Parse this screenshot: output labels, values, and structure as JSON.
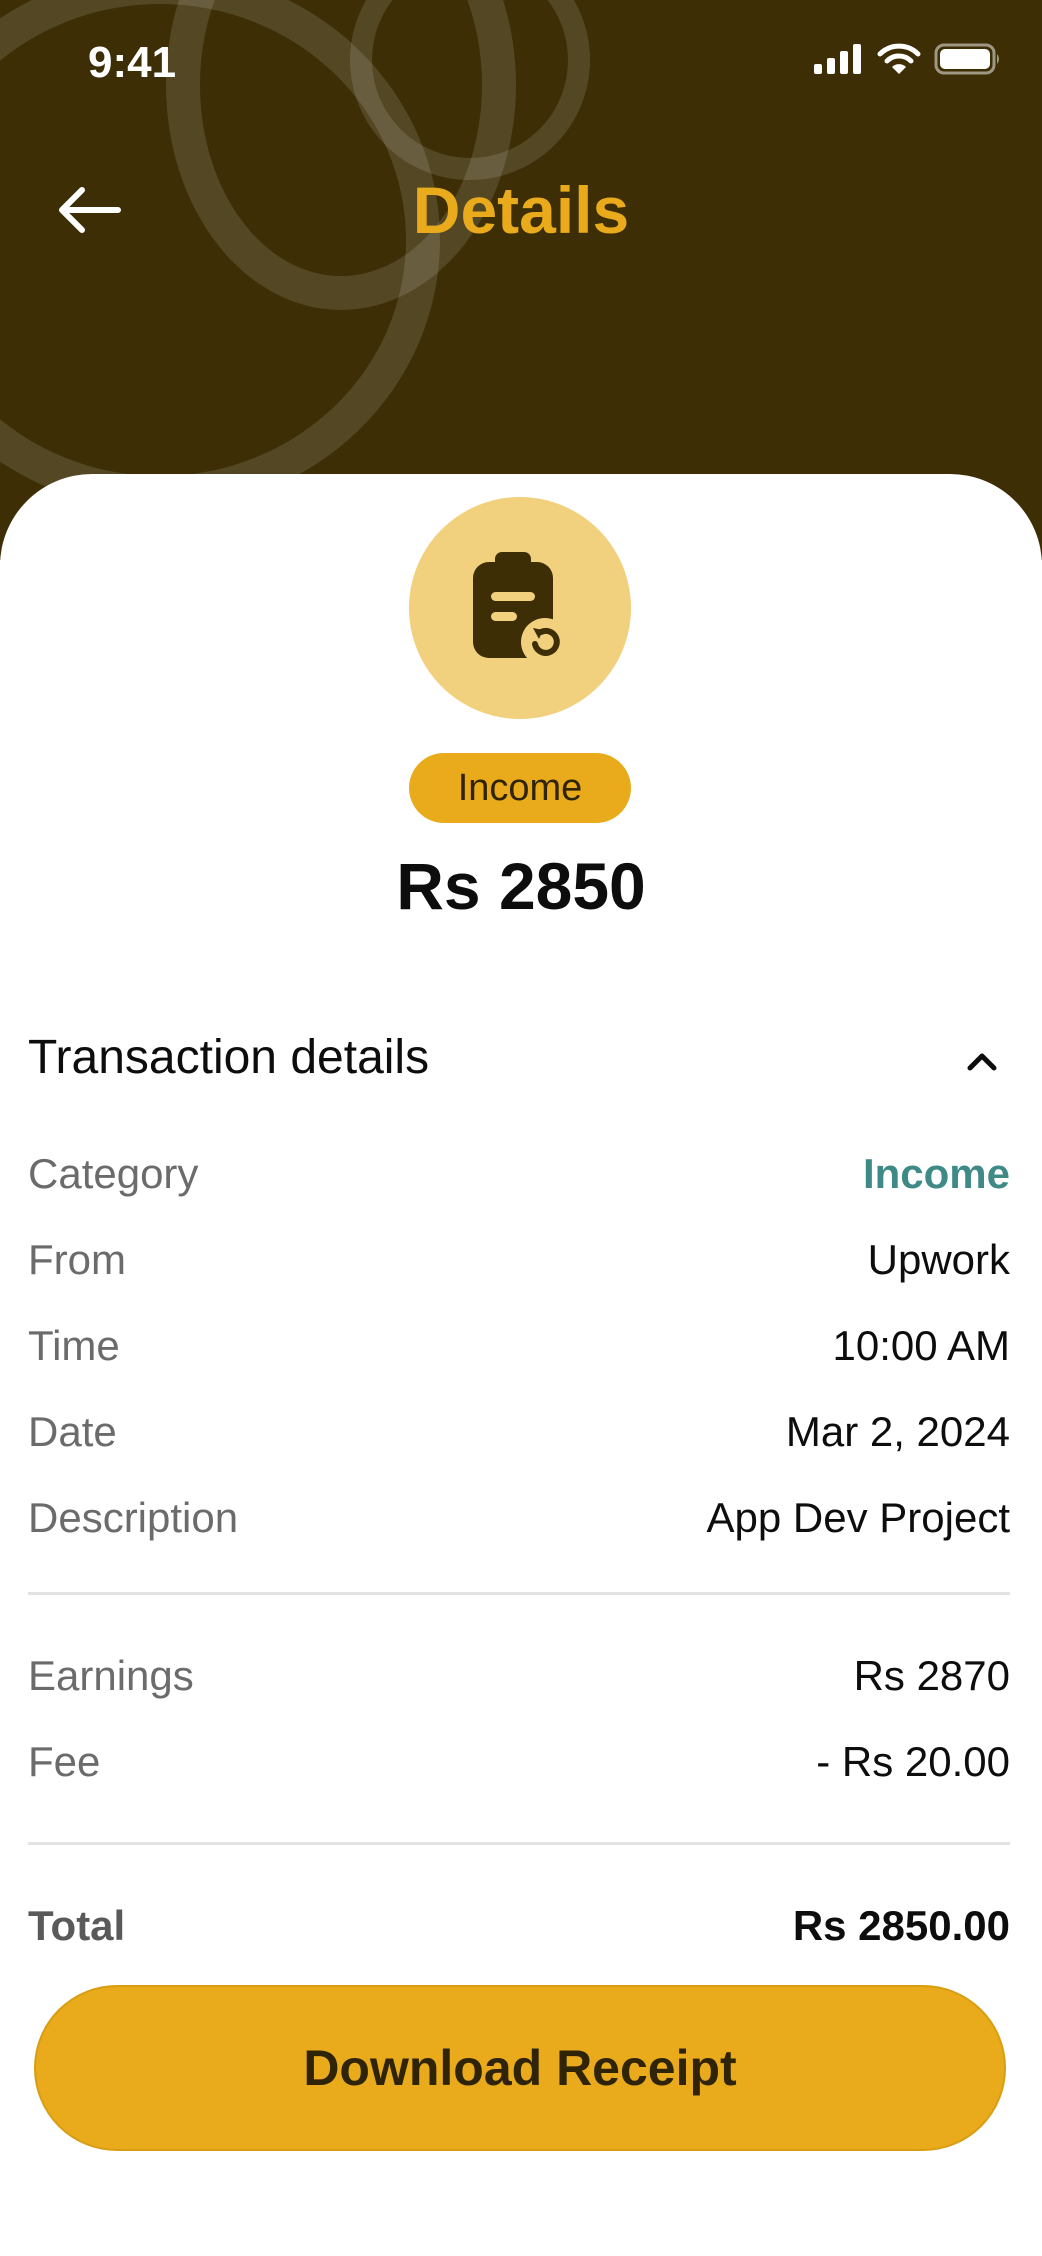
{
  "status_bar": {
    "time": "9:41"
  },
  "header": {
    "title": "Details"
  },
  "transaction": {
    "type_badge": "Income",
    "amount": "Rs 2850"
  },
  "details": {
    "section_title": "Transaction details",
    "rows": [
      {
        "label": "Category",
        "value": "Income"
      },
      {
        "label": "From",
        "value": "Upwork"
      },
      {
        "label": "Time",
        "value": "10:00 AM"
      },
      {
        "label": "Date",
        "value": "Mar 2, 2024"
      },
      {
        "label": "Description",
        "value": "App Dev Project"
      }
    ],
    "breakdown": [
      {
        "label": "Earnings",
        "value": "Rs 2870"
      },
      {
        "label": "Fee",
        "value": "- Rs 20.00"
      }
    ],
    "total": {
      "label": "Total",
      "value": "Rs 2850.00"
    }
  },
  "actions": {
    "download_label": "Download Receipt"
  },
  "colors": {
    "header_bg": "#3d2e06",
    "accent": "#e9ab1b",
    "avatar_bg": "#f2d17e",
    "category_value": "#3f8a86"
  },
  "icons": {
    "back": "arrow-left-icon",
    "transaction": "receipt-refresh-icon",
    "collapse": "chevron-up-icon"
  }
}
